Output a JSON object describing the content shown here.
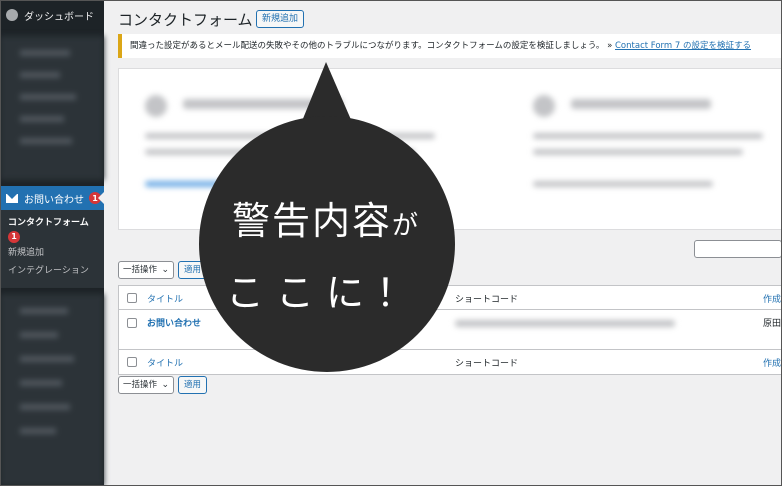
{
  "sidebar": {
    "dashboard": "ダッシュボード",
    "contact": {
      "label": "お問い合わせ",
      "badge": "1"
    },
    "submenu": [
      {
        "label": "コンタクトフォーム",
        "badge": "1"
      },
      {
        "label": "新規追加"
      },
      {
        "label": "インテグレーション"
      }
    ]
  },
  "page": {
    "title": "コンタクトフォーム",
    "add_new": "新規追加"
  },
  "notice": {
    "message": "間違った設定があるとメール配送の失敗やその他のトラブルにつながります。コンタクトフォームの設定を検証しましょう。 »",
    "link": "Contact Form 7 の設定を検証する"
  },
  "toolbar": {
    "bulk": "一括操作",
    "apply": "適用"
  },
  "table": {
    "headers": {
      "title": "タイトル",
      "shortcode": "ショートコード",
      "author": "作成"
    },
    "rows": [
      {
        "title": "お問い合わせ",
        "author": "原田"
      }
    ]
  },
  "callout": {
    "line1_main": "警告内容",
    "line1_small": "が",
    "line2": "ここに！"
  },
  "colors": {
    "sidebar_bg": "#1d2327",
    "accent": "#2271b1",
    "warning": "#dba617",
    "badge": "#d63638",
    "bubble": "#2b2b2b"
  }
}
